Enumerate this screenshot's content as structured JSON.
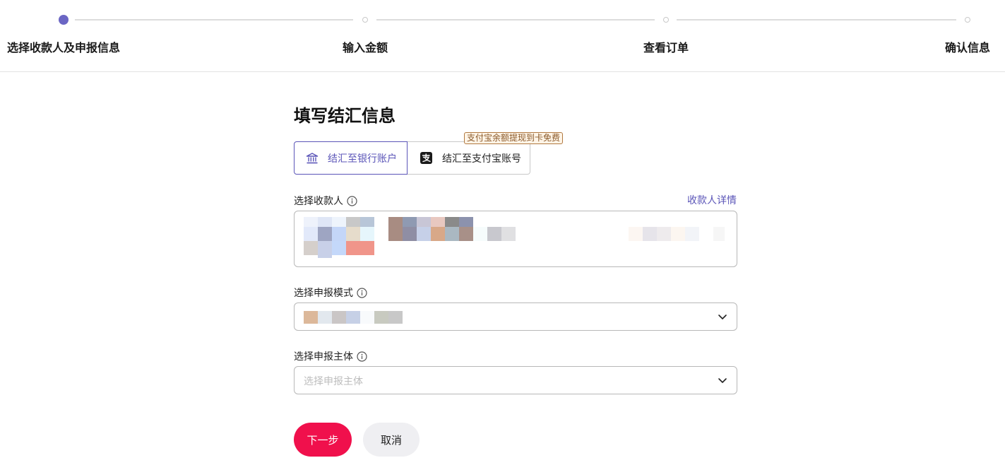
{
  "stepper": {
    "steps": [
      {
        "label": "选择收款人及申报信息",
        "state": "active"
      },
      {
        "label": "输入金额",
        "state": "pending"
      },
      {
        "label": "查看订单",
        "state": "pending"
      },
      {
        "label": "确认信息",
        "state": "pending"
      }
    ]
  },
  "form": {
    "title": "填写结汇信息",
    "tabs": [
      {
        "label": "结汇至银行账户",
        "icon": "bank-icon",
        "selected": true
      },
      {
        "label": "结汇至支付宝账号",
        "icon": "alipay-icon",
        "selected": false
      }
    ],
    "promo_badge": "支付宝余额提现到卡免费",
    "payee": {
      "label": "选择收款人",
      "detail_link": "收款人详情",
      "value_state": "pixelated"
    },
    "declare_mode": {
      "label": "选择申报模式",
      "value_state": "pixelated"
    },
    "declare_entity": {
      "label": "选择申报主体",
      "placeholder": "选择申报主体"
    },
    "buttons": {
      "next": "下一步",
      "cancel": "取消"
    }
  },
  "colors": {
    "accent": "#5b55b8",
    "primary_button": "#f0104c",
    "badge_text": "#8a5a2b"
  }
}
